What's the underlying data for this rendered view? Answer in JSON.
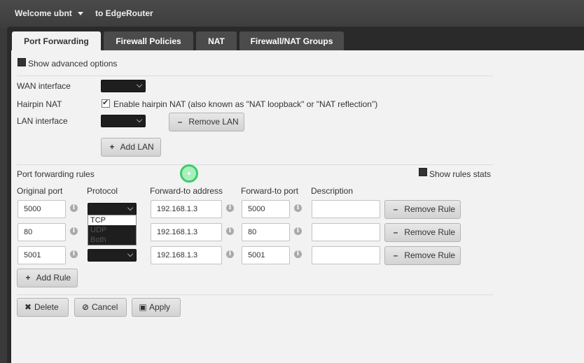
{
  "topbar": {
    "welcome": "Welcome ubnt",
    "target": "to EdgeRouter"
  },
  "tabs": [
    {
      "label": "Port Forwarding",
      "active": true
    },
    {
      "label": "Firewall Policies",
      "active": false
    },
    {
      "label": "NAT",
      "active": false
    },
    {
      "label": "Firewall/NAT Groups",
      "active": false
    }
  ],
  "advanced": {
    "label": "Show advanced options",
    "checked": false
  },
  "wan": {
    "label": "WAN interface",
    "value": ""
  },
  "hairpin": {
    "label": "Hairpin NAT",
    "checkbox_label": "Enable hairpin NAT (also known as \"NAT loopback\" or \"NAT reflection\")",
    "checked": true
  },
  "lan": {
    "label": "LAN interface",
    "value": "",
    "remove_label": "Remove LAN",
    "add_label": "Add LAN"
  },
  "rules_section": {
    "title": "Port forwarding rules",
    "stats_label": "Show rules stats",
    "stats_checked": false
  },
  "columns": {
    "original_port": "Original port",
    "protocol": "Protocol",
    "forward_address": "Forward-to address",
    "forward_port": "Forward-to port",
    "description": "Description"
  },
  "rules": [
    {
      "original_port": "5000",
      "protocol": "",
      "forward_address": "192.168.1.3",
      "forward_port": "5000",
      "description": "",
      "remove_label": "Remove Rule"
    },
    {
      "original_port": "80",
      "protocol": "",
      "forward_address": "192.168.1.3",
      "forward_port": "80",
      "description": "",
      "remove_label": "Remove Rule"
    },
    {
      "original_port": "5001",
      "protocol": "",
      "forward_address": "192.168.1.3",
      "forward_port": "5001",
      "description": "",
      "remove_label": "Remove Rule"
    }
  ],
  "protocol_dropdown": {
    "options": [
      "TCP",
      "UDP",
      "Both"
    ],
    "selected": "TCP"
  },
  "add_rule_label": "Add Rule",
  "footer": {
    "delete_label": "Delete",
    "cancel_label": "Cancel",
    "apply_label": "Apply"
  },
  "colors": {
    "accent_cursor": "#34d16a",
    "panel_bg": "#f2f2f2",
    "tab_inactive": "#4b4b4b"
  },
  "icons": {
    "plus": "plus-icon",
    "minus": "minus-icon",
    "delete": "x-icon",
    "cancel": "ban-icon",
    "apply": "save-icon",
    "info": "info-icon"
  }
}
